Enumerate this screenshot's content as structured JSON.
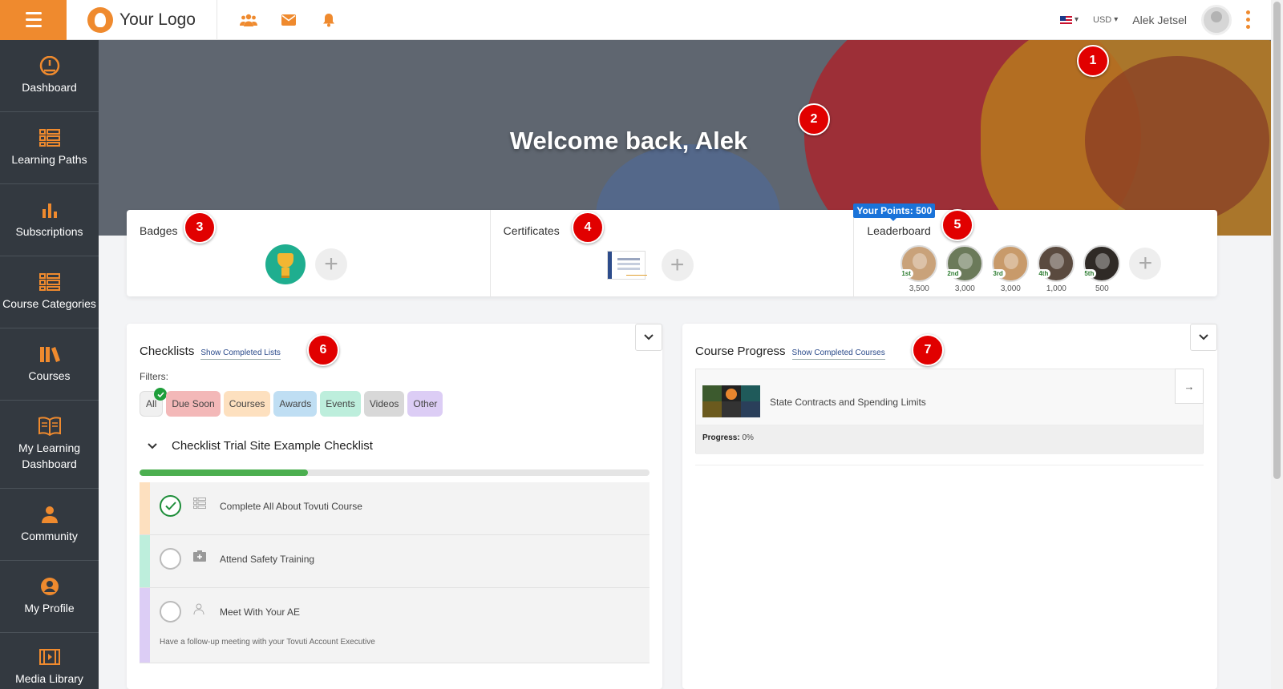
{
  "header": {
    "logo_text": "Your Logo",
    "currency": "USD",
    "user_name": "Alek Jetsel"
  },
  "sidebar": {
    "items": [
      {
        "label": "Dashboard",
        "icon": "dashboard-gauge-icon"
      },
      {
        "label": "Learning Paths",
        "icon": "list-grid-icon"
      },
      {
        "label": "Subscriptions",
        "icon": "bar-chart-icon"
      },
      {
        "label": "Course Categories",
        "icon": "list-grid-icon"
      },
      {
        "label": "Courses",
        "icon": "books-icon"
      },
      {
        "label": "My Learning Dashboard",
        "icon": "open-book-icon"
      },
      {
        "label": "Community",
        "icon": "user-group-icon"
      },
      {
        "label": "My Profile",
        "icon": "user-circle-icon"
      },
      {
        "label": "Media Library",
        "icon": "film-icon"
      }
    ]
  },
  "hero": {
    "title": "Welcome back, Alek"
  },
  "markers": [
    "1",
    "2",
    "3",
    "4",
    "5",
    "6",
    "7"
  ],
  "stats": {
    "badges_title": "Badges",
    "certificates_title": "Certificates",
    "leaderboard_title": "Leaderboard",
    "points_tag": "Your Points: 500",
    "leaders": [
      {
        "rank": "1st",
        "points": "3,500",
        "color": "#c9a27a"
      },
      {
        "rank": "2nd",
        "points": "3,000",
        "color": "#6b7a5a"
      },
      {
        "rank": "3rd",
        "points": "3,000",
        "color": "#c89a6a"
      },
      {
        "rank": "4th",
        "points": "1,000",
        "color": "#5a4a3f"
      },
      {
        "rank": "5th",
        "points": "500",
        "color": "#2f2a26"
      }
    ]
  },
  "checklists": {
    "title": "Checklists",
    "show_completed": "Show Completed Lists",
    "filters_label": "Filters:",
    "filters": [
      {
        "label": "All",
        "bg": "#f0f0f0",
        "selected": true
      },
      {
        "label": "Due Soon",
        "bg": "#f3b8b8",
        "selected": false
      },
      {
        "label": "Courses",
        "bg": "#fde0bf",
        "selected": false
      },
      {
        "label": "Awards",
        "bg": "#bfdef3",
        "selected": false
      },
      {
        "label": "Events",
        "bg": "#bdeedc",
        "selected": false
      },
      {
        "label": "Videos",
        "bg": "#d8d8d8",
        "selected": false
      },
      {
        "label": "Other",
        "bg": "#dccdf5",
        "selected": false
      }
    ],
    "checklist_name": "Checklist Trial Site Example Checklist",
    "progress": 0.33,
    "tasks": [
      {
        "text": "Complete All About Tovuti Course",
        "done": true,
        "bar": "#fde0bf",
        "type_icon": "course-list-icon",
        "desc": ""
      },
      {
        "text": "Attend Safety Training",
        "done": false,
        "bar": "#bdeedc",
        "type_icon": "calendar-event-icon",
        "desc": ""
      },
      {
        "text": "Meet With Your AE",
        "done": false,
        "bar": "#dccdf5",
        "type_icon": "person-icon",
        "desc": "Have a follow-up meeting with your Tovuti Account Executive"
      }
    ]
  },
  "course_progress": {
    "title": "Course Progress",
    "show_completed": "Show Completed Courses",
    "course_title": "State Contracts and Spending Limits",
    "progress_label": "Progress:",
    "progress_value": "0%"
  },
  "colors": {
    "accent": "#ef8a2e",
    "sidebar": "#333940",
    "marker": "#e10000"
  }
}
